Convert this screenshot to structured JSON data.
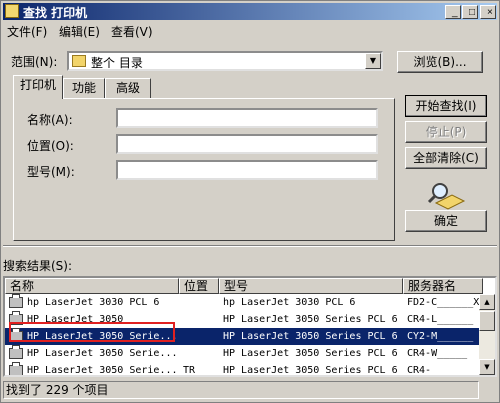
{
  "window": {
    "title": "查找 打印机"
  },
  "title_buttons": {
    "minimize": "_",
    "maximize": "□",
    "close": "×"
  },
  "menu": [
    "文件(F)",
    "编辑(E)",
    "查看(V)"
  ],
  "scope": {
    "label": "范围(N):",
    "value": "整个 目录",
    "browse_label": "浏览(B)..."
  },
  "tabs": [
    "打印机",
    "功能",
    "高级"
  ],
  "fields": [
    {
      "label": "名称(A):",
      "value": ""
    },
    {
      "label": "位置(O):",
      "value": ""
    },
    {
      "label": "型号(M):",
      "value": ""
    }
  ],
  "actions": {
    "start": "开始查找(I)",
    "stop": "停止(P)",
    "clear": "全部清除(C)",
    "ok": "确定"
  },
  "results": {
    "label": "搜索结果(S):",
    "columns": [
      "名称",
      "位置",
      "型号",
      "服务器名"
    ],
    "rows": [
      {
        "name": "hp LaserJet 3030 PCL 6",
        "location": "",
        "model": "hp LaserJet 3030 PCL 6",
        "server": "FD2-C______X"
      },
      {
        "name": "HP LaserJet 3050",
        "location": "",
        "model": "HP LaserJet 3050 Series PCL 6",
        "server": "CR4-L______"
      },
      {
        "name": "HP LaserJet 3050 Serie...",
        "location": "",
        "model": "HP LaserJet 3050 Series PCL 6",
        "server": "CY2-M______"
      },
      {
        "name": "HP LaserJet 3050 Serie...",
        "location": "",
        "model": "HP LaserJet 3050 Series PCL 6",
        "server": "CR4-W_____"
      },
      {
        "name": "HP LaserJet 3050 Serie...",
        "location": "TR",
        "model": "HP LaserJet 3050 Series PCL 6",
        "server": "CR4-______"
      }
    ],
    "selected_row": 2
  },
  "status": {
    "text": "找到了 229 个项目"
  },
  "colors": {
    "title_active": "#0a246a",
    "selection": "#0a246a",
    "face": "#d4d0c8",
    "highlight_box": "#e02020"
  }
}
